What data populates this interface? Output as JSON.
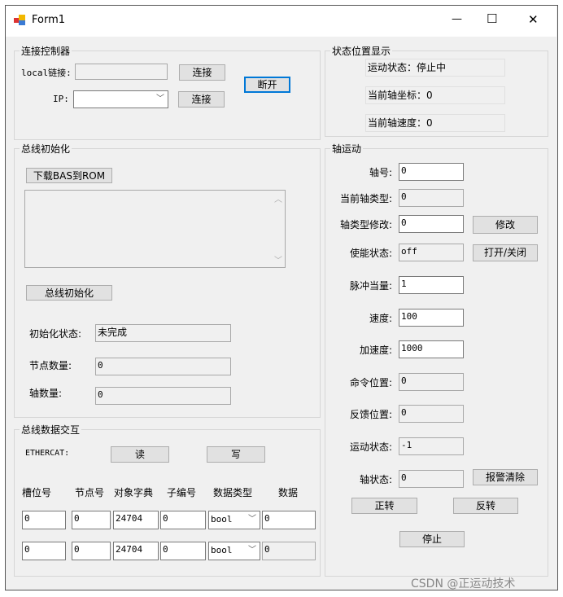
{
  "window": {
    "title": "Form1",
    "minimize": "—",
    "maximize": "☐",
    "close": "✕"
  },
  "connect": {
    "title": "连接控制器",
    "local_label": "local链接:",
    "local_value": "",
    "local_btn": "连接",
    "ip_label": "IP:",
    "ip_value": "",
    "ip_btn": "连接",
    "disconnect_btn": "断开"
  },
  "status": {
    "title": "状态位置显示",
    "motion": "运动状态：停止中",
    "coord": "当前轴坐标：0",
    "speed": "当前轴速度：0"
  },
  "businit": {
    "title": "总线初始化",
    "download_btn": "下载BAS到ROM",
    "log": "",
    "init_btn": "总线初始化",
    "init_state_label": "初始化状态:",
    "init_state": "未完成",
    "node_label": "节点数量:",
    "node_value": "0",
    "axis_label": "轴数量:",
    "axis_value": "0"
  },
  "busdata": {
    "title": "总线数据交互",
    "ethercat_label": "ETHERCAT:",
    "read_btn": "读",
    "write_btn": "写",
    "headers": [
      "槽位号",
      "节点号",
      "对象字典",
      "子编号",
      "数据类型",
      "数据"
    ],
    "rows": [
      [
        "0",
        "0",
        "24704",
        "0",
        "bool",
        "0"
      ],
      [
        "0",
        "0",
        "24704",
        "0",
        "bool",
        "0"
      ]
    ]
  },
  "axis": {
    "title": "轴运动",
    "fields": [
      {
        "label": "轴号:",
        "value": "0",
        "readonly": false
      },
      {
        "label": "当前轴类型:",
        "value": "0",
        "readonly": true
      },
      {
        "label": "轴类型修改:",
        "value": "0",
        "readonly": false
      },
      {
        "label": "使能状态:",
        "value": "off",
        "readonly": true
      },
      {
        "label": "脉冲当量:",
        "value": "1",
        "readonly": false
      },
      {
        "label": "速度:",
        "value": "100",
        "readonly": false
      },
      {
        "label": "加速度:",
        "value": "1000",
        "readonly": false
      },
      {
        "label": "命令位置:",
        "value": "0",
        "readonly": true
      },
      {
        "label": "反馈位置:",
        "value": "0",
        "readonly": true
      },
      {
        "label": "运动状态:",
        "value": "-1",
        "readonly": true
      },
      {
        "label": "轴状态:",
        "value": "0",
        "readonly": true
      }
    ],
    "modify_btn": "修改",
    "enable_btn": "打开/关闭",
    "clear_alarm_btn": "报警清除",
    "forward_btn": "正转",
    "reverse_btn": "反转",
    "stop_btn": "停止"
  },
  "watermark": "CSDN @正运动技术"
}
